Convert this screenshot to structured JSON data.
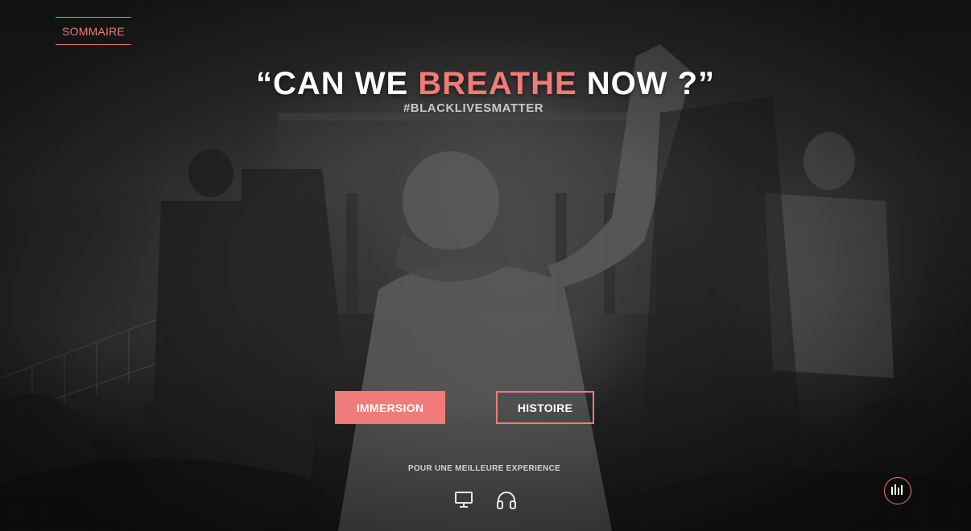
{
  "nav": {
    "sommaire_label": "SOMMAIRE"
  },
  "hero": {
    "title_before": "“CAN WE ",
    "title_accent": "BREATHE",
    "title_after": " NOW ?”",
    "hashtag": "#BLACKLIVESMATTER"
  },
  "actions": {
    "immersion_label": "IMMERSION",
    "histoire_label": "HISTOIRE"
  },
  "footer": {
    "experience_text": "POUR UNE MEILLEURE EXPERIENCE",
    "icons": [
      "desktop-icon",
      "headphones-icon"
    ]
  },
  "audio": {
    "icon": "audio-bars-icon"
  },
  "colors": {
    "accent": "#f07b78",
    "text": "#ffffff",
    "background": "#1b1b1b"
  }
}
